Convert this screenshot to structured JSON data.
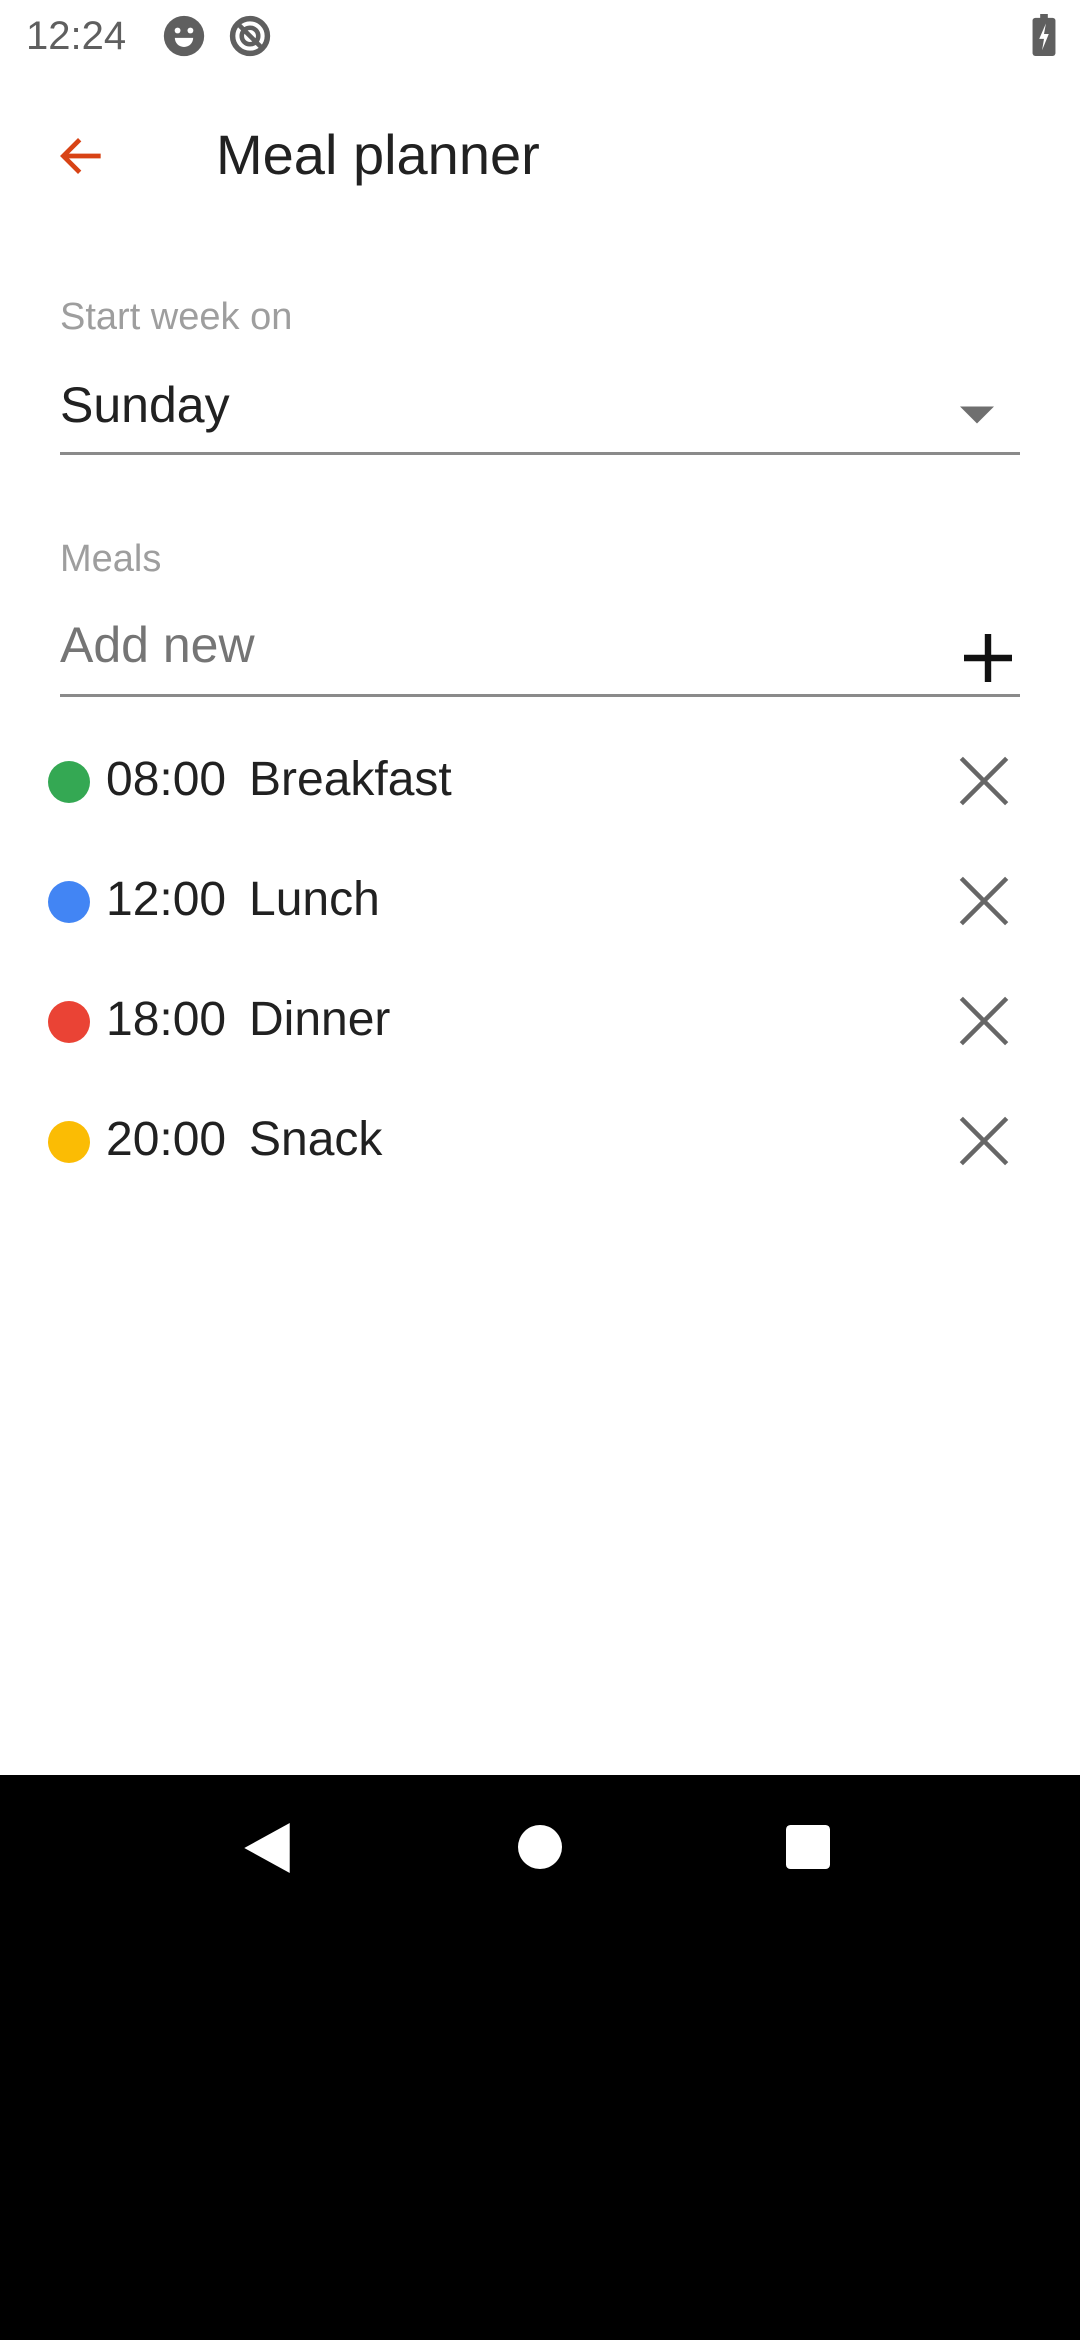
{
  "status_bar": {
    "time": "12:24",
    "icons": [
      "face-icon",
      "no-sync-icon",
      "battery-charging-icon"
    ]
  },
  "header": {
    "title": "Meal planner",
    "back_icon": "arrow-left-icon"
  },
  "start_week": {
    "label": "Start week on",
    "value": "Sunday"
  },
  "meals": {
    "label": "Meals",
    "add_placeholder": "Add new",
    "items": [
      {
        "time": "08:00",
        "name": "Breakfast",
        "color": "#34A853"
      },
      {
        "time": "12:00",
        "name": "Lunch",
        "color": "#4285F4"
      },
      {
        "time": "18:00",
        "name": "Dinner",
        "color": "#EA4335"
      },
      {
        "time": "20:00",
        "name": "Snack",
        "color": "#FBBC04"
      }
    ]
  },
  "accent": "#D84315"
}
